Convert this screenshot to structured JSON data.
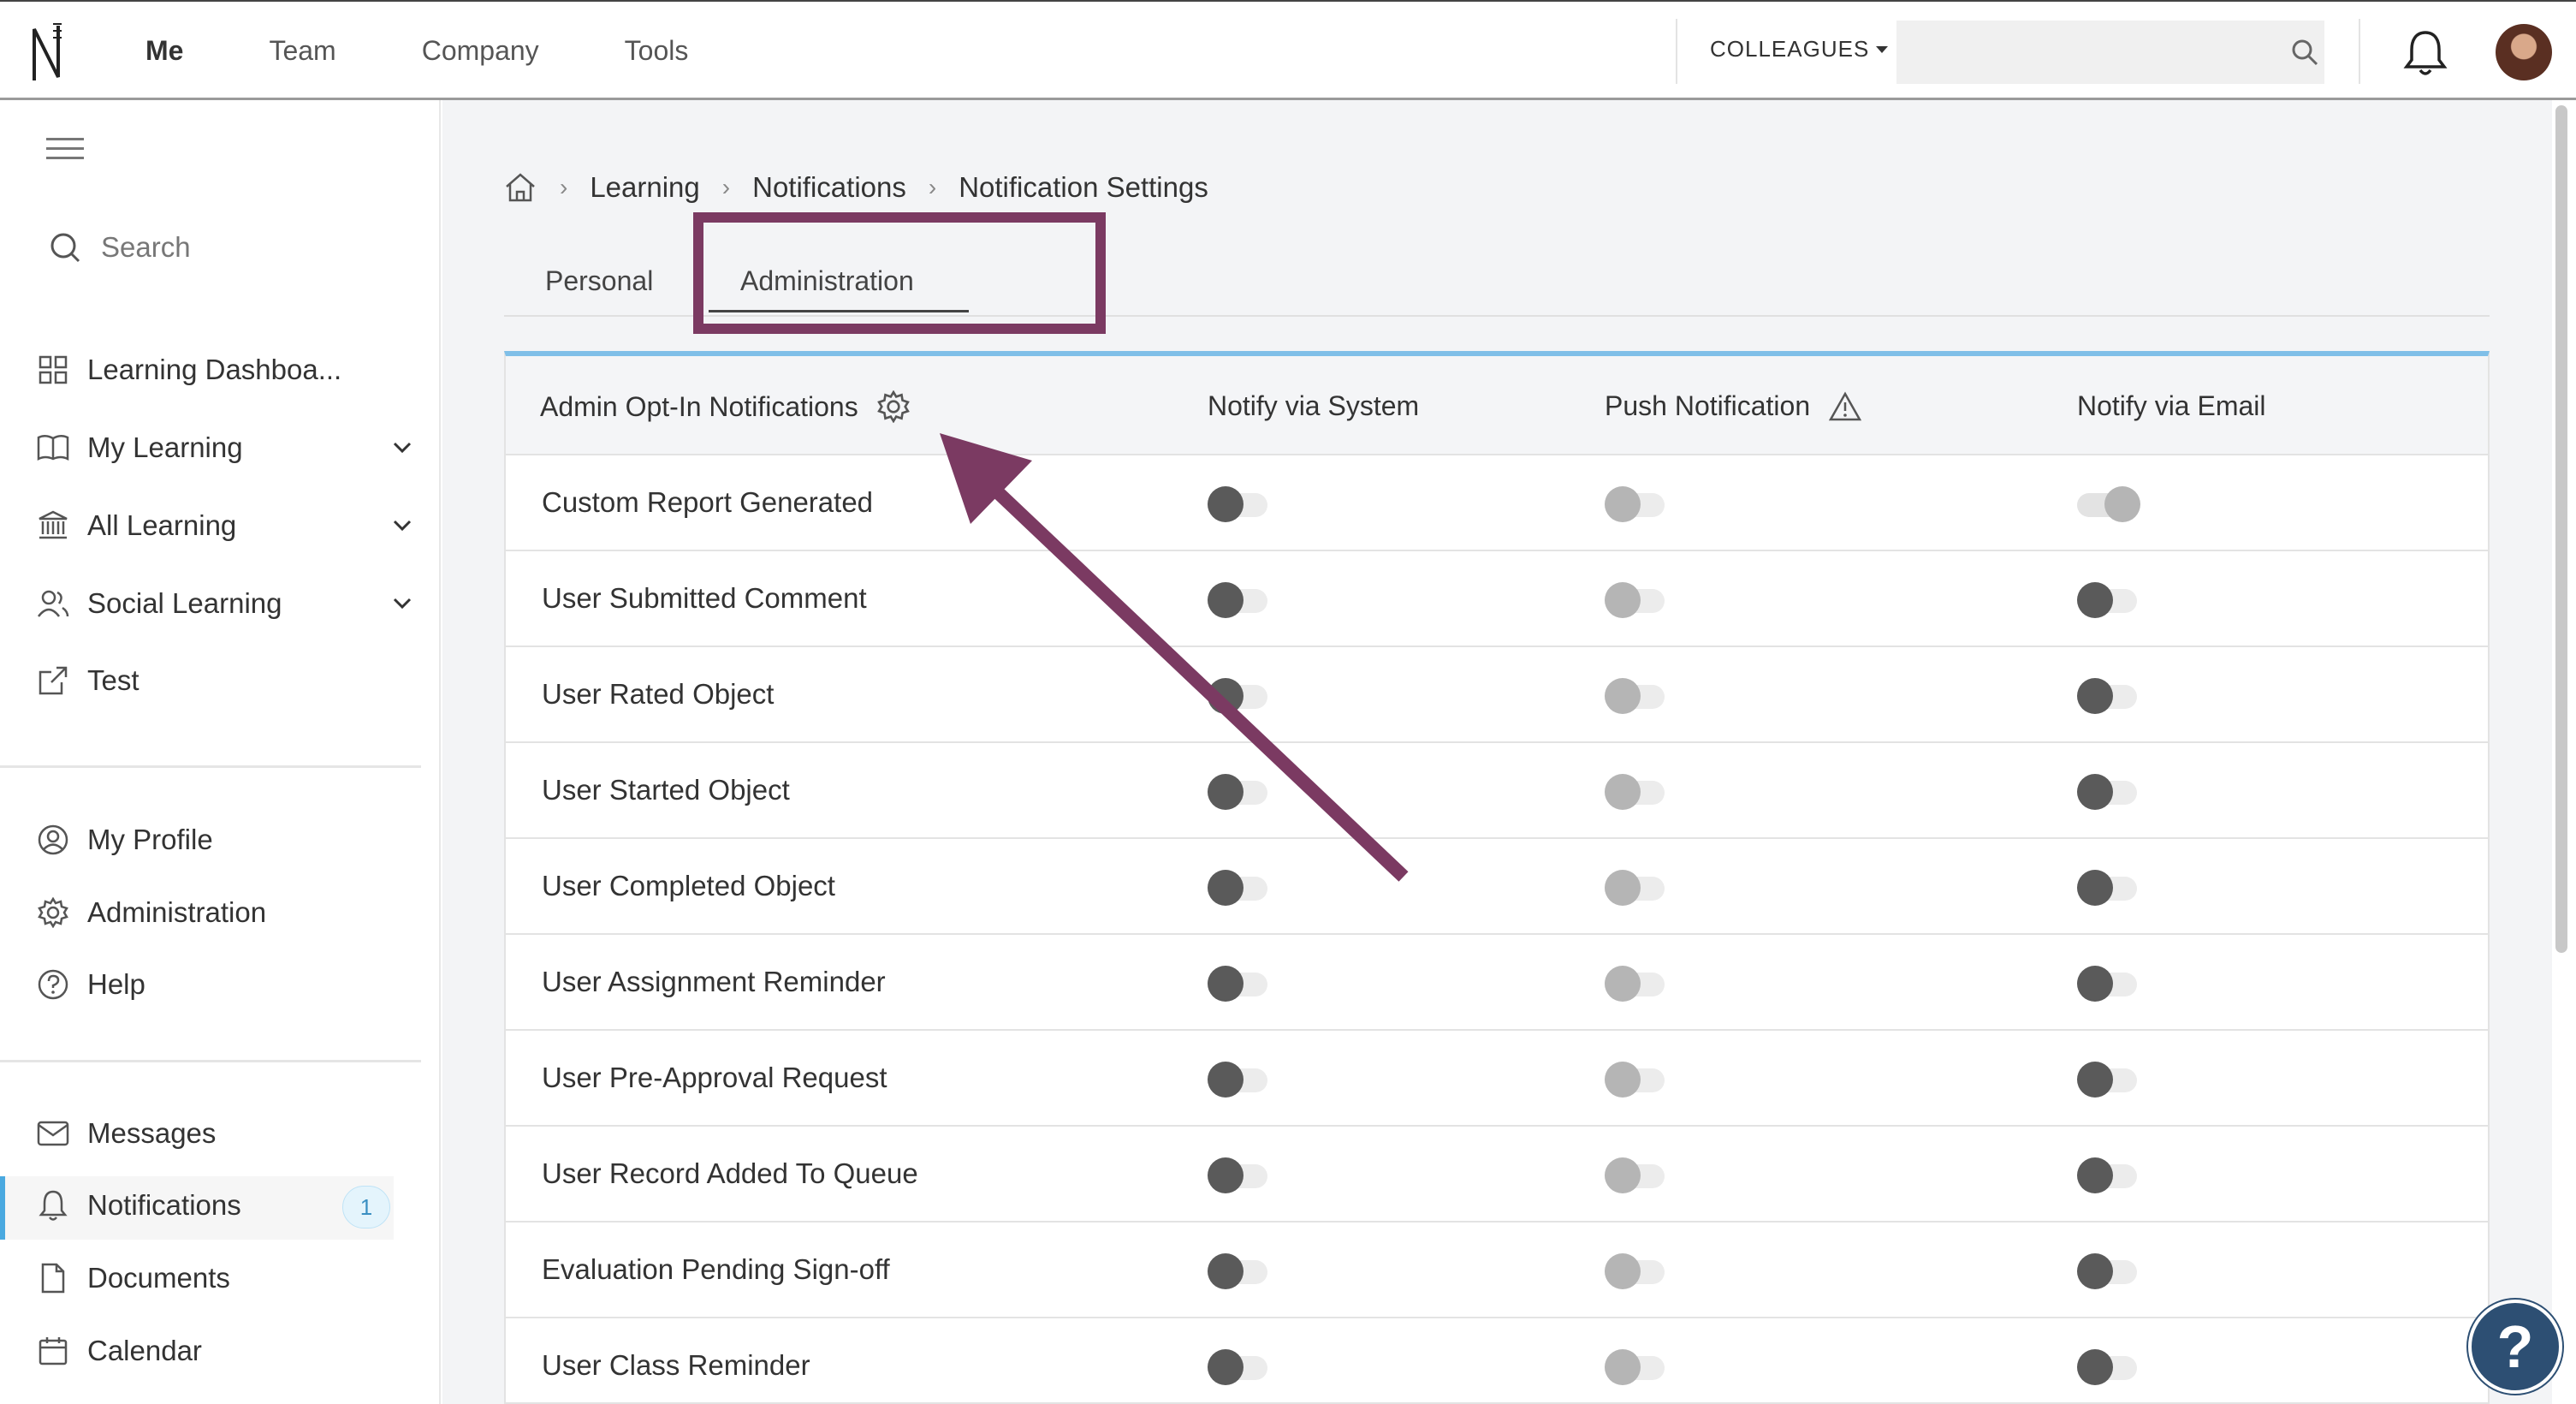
{
  "topnav": {
    "items": [
      "Me",
      "Team",
      "Company",
      "Tools"
    ]
  },
  "header": {
    "colleagues_label": "COLLEAGUES",
    "search_placeholder": ""
  },
  "sidebar": {
    "search_placeholder": "Search",
    "items": [
      {
        "label": "Learning Dashboa...",
        "icon": "grid-icon"
      },
      {
        "label": "My Learning",
        "icon": "book-icon"
      },
      {
        "label": "All Learning",
        "icon": "institution-icon"
      },
      {
        "label": "Social Learning",
        "icon": "users-icon"
      },
      {
        "label": "Test",
        "icon": "external-link-icon"
      }
    ],
    "items2": [
      {
        "label": "My Profile",
        "icon": "profile-icon"
      },
      {
        "label": "Administration",
        "icon": "gear-icon"
      },
      {
        "label": "Help",
        "icon": "help-icon"
      }
    ],
    "items3": [
      {
        "label": "Messages",
        "icon": "mail-icon"
      },
      {
        "label": "Notifications",
        "icon": "bell-icon"
      },
      {
        "label": "Documents",
        "icon": "document-icon"
      },
      {
        "label": "Calendar",
        "icon": "calendar-icon"
      }
    ],
    "notification_count": "1"
  },
  "breadcrumb": [
    "Learning",
    "Notifications",
    "Notification Settings"
  ],
  "tabs": [
    "Personal",
    "Administration"
  ],
  "table": {
    "headers": [
      "Admin Opt-In Notifications",
      "Notify via System",
      "Push Notification",
      "Notify via Email"
    ],
    "rows": [
      {
        "name": "Custom Report Generated",
        "system": "off",
        "push": "off",
        "email": "on"
      },
      {
        "name": "User Submitted Comment",
        "system": "off",
        "push": "off",
        "email": "off"
      },
      {
        "name": "User Rated Object",
        "system": "off",
        "push": "off",
        "email": "off"
      },
      {
        "name": "User Started Object",
        "system": "off",
        "push": "off",
        "email": "off"
      },
      {
        "name": "User Completed Object",
        "system": "off",
        "push": "off",
        "email": "off"
      },
      {
        "name": "User Assignment Reminder",
        "system": "off",
        "push": "off",
        "email": "off"
      },
      {
        "name": "User Pre-Approval Request",
        "system": "off",
        "push": "off",
        "email": "off"
      },
      {
        "name": "User Record Added To Queue",
        "system": "off",
        "push": "off",
        "email": "off"
      },
      {
        "name": "Evaluation Pending Sign-off",
        "system": "off",
        "push": "off",
        "email": "off"
      },
      {
        "name": "User Class Reminder",
        "system": "off",
        "push": "off",
        "email": "off"
      }
    ]
  },
  "help_button": "?",
  "colors": {
    "accent": "#7b3a62",
    "table_top_border": "#7fbfe8",
    "help_bg": "#2d4f73"
  }
}
